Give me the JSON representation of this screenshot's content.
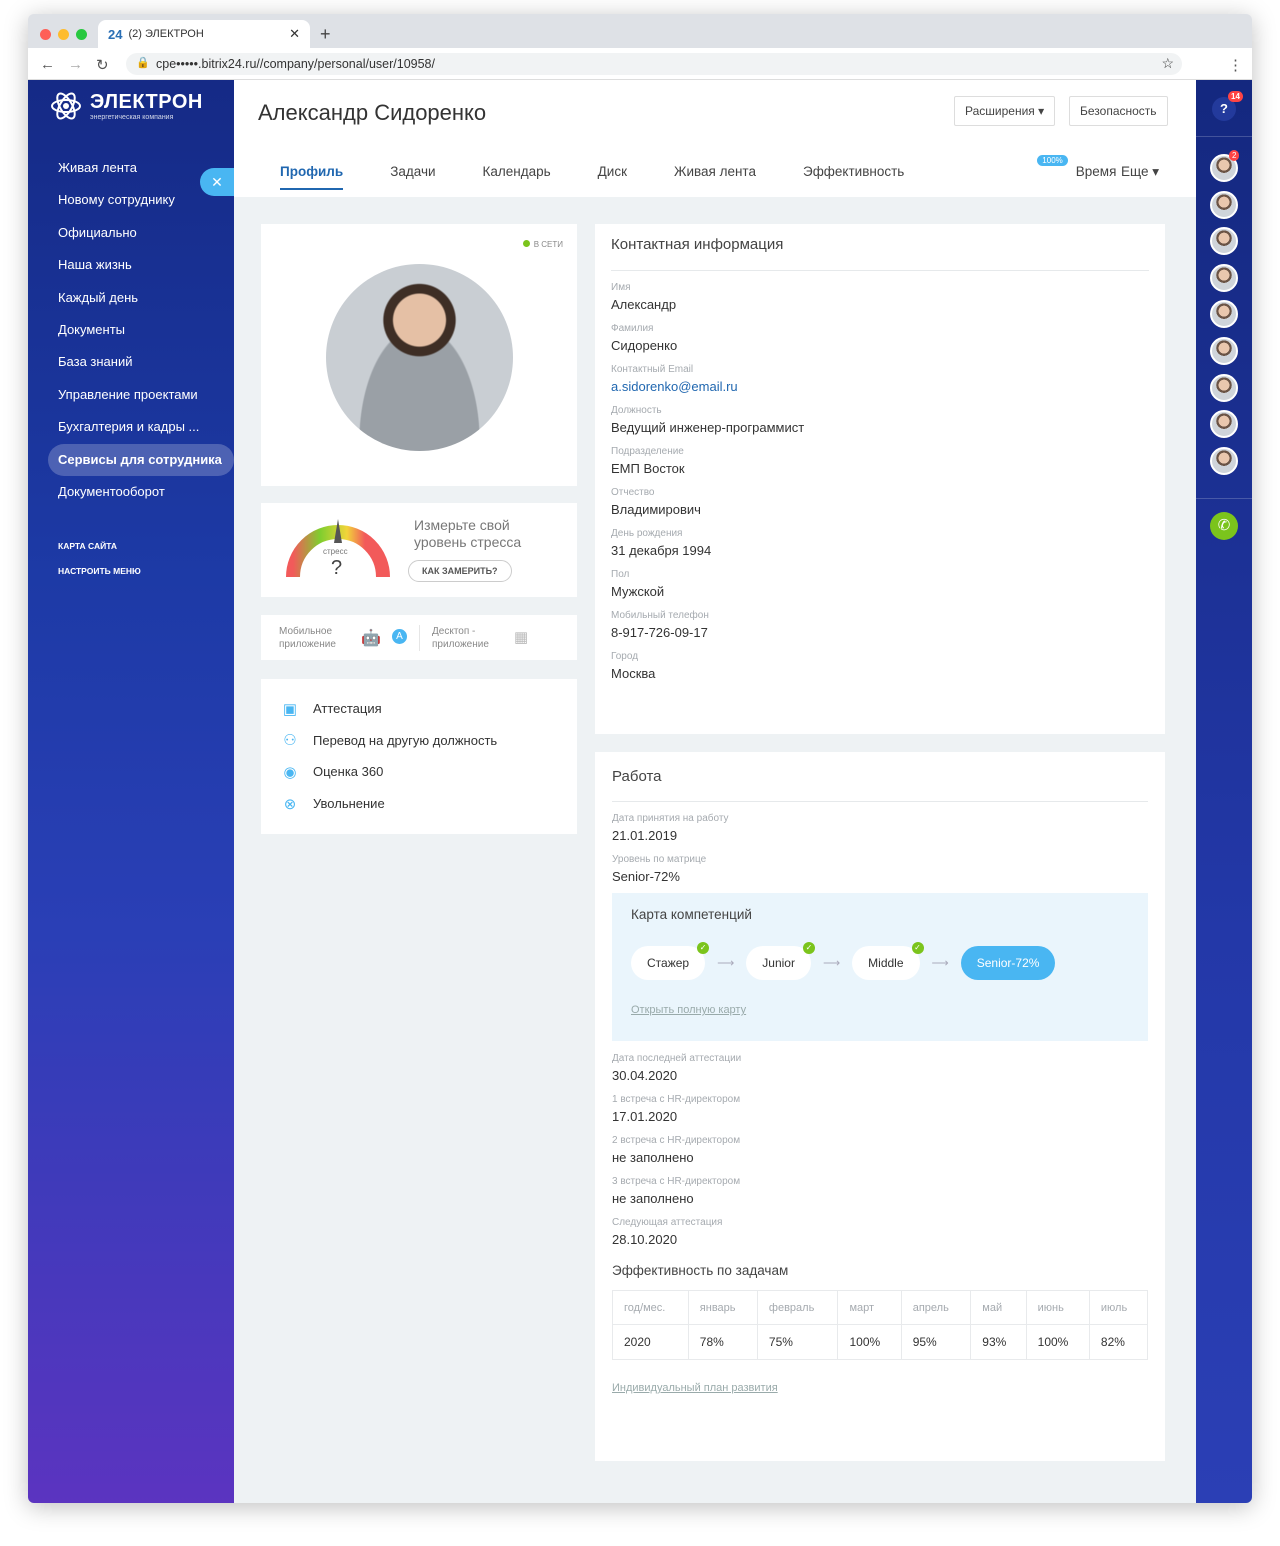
{
  "browser": {
    "tab_title": "(2) ЭЛЕКТРОН",
    "tab_logo": "24",
    "url": "cpe•••••.bitrix24.ru//company/personal/user/10958/"
  },
  "logo": {
    "name": "ЭЛЕКТРОН",
    "subtitle": "энергетическая компания"
  },
  "sidebar": {
    "items": [
      "Живая лента",
      "Новому сотруднику",
      "Официально",
      "Наша жизнь",
      "Каждый день",
      "Документы",
      "База знаний",
      "Управление проектами",
      "Бухгалтерия и кадры ...",
      "Сервисы для сотрудника",
      "Документооборот"
    ],
    "active": "Сервисы для сотрудника",
    "sitemap": "КАРТА САЙТА",
    "configure": "НАСТРОИТЬ МЕНЮ"
  },
  "header": {
    "title": "Александр Сидоренко",
    "extensions": "Расширения",
    "security": "Безопасность",
    "tabs": [
      "Профиль",
      "Задачи",
      "Календарь",
      "Диск",
      "Живая лента",
      "Эффективность",
      "Время"
    ],
    "more": "Еще",
    "efficiency_badge": "100%"
  },
  "profile": {
    "status": "В СЕТИ",
    "status_color": "#7bc41c"
  },
  "stress": {
    "label": "стресс",
    "value": "?",
    "text": "Измерьте свой уровень стресса",
    "button": "КАК ЗАМЕРИТЬ?"
  },
  "apps": {
    "mobile": "Мобильное приложение",
    "desktop": "Десктоп - приложение"
  },
  "actions": [
    {
      "icon": "calendar-check-icon",
      "label": "Аттестация"
    },
    {
      "icon": "users-icon",
      "label": "Перевод на другую должность"
    },
    {
      "icon": "eye-icon",
      "label": "Оценка 360"
    },
    {
      "icon": "close-circle-icon",
      "label": "Увольнение"
    }
  ],
  "contact": {
    "title": "Контактная информация",
    "fields": [
      {
        "label": "Имя",
        "value": "Александр"
      },
      {
        "label": "Фамилия",
        "value": "Сидоренко"
      },
      {
        "label": "Контактный Email",
        "value": "a.sidorenko@email.ru"
      },
      {
        "label": "Должность",
        "value": "Ведущий инженер-программист"
      },
      {
        "label": "Подразделение",
        "value": "ЕМП Восток"
      },
      {
        "label": "Отчество",
        "value": "Владимирович"
      },
      {
        "label": "День рождения",
        "value": "31 декабря 1994"
      },
      {
        "label": "Пол",
        "value": "Мужской"
      },
      {
        "label": "Мобильный телефон",
        "value": "8-917-726-09-17"
      },
      {
        "label": "Город",
        "value": "Москва"
      }
    ]
  },
  "work": {
    "title": "Работа",
    "fields_top": [
      {
        "label": "Дата принятия на работу",
        "value": "21.01.2019"
      },
      {
        "label": "Уровень по матрице",
        "value": "Senior-72%"
      }
    ],
    "competence": {
      "title": "Карта компетенций",
      "stages": [
        "Стажер",
        "Junior",
        "Middle"
      ],
      "current": "Senior-72%",
      "link": "Открыть полную карту"
    },
    "fields_bottom": [
      {
        "label": "Дата последней аттестации",
        "value": "30.04.2020"
      },
      {
        "label": "1 встреча с HR-директором",
        "value": "17.01.2020"
      },
      {
        "label": "2 встреча с HR-директором",
        "value": "не заполнено"
      },
      {
        "label": "3 встреча с HR-директором",
        "value": "не заполнено"
      },
      {
        "label": "Следующая аттестация",
        "value": "28.10.2020"
      }
    ],
    "efficiency_title": "Эффективность по задачам",
    "table": {
      "headers": [
        "год/мес.",
        "январь",
        "февраль",
        "март",
        "апрель",
        "май",
        "июнь",
        "июль"
      ],
      "rows": [
        [
          "2020",
          "78%",
          "75%",
          "100%",
          "95%",
          "93%",
          "100%",
          "82%"
        ]
      ]
    },
    "plan_link": "Индивидуальный план развития"
  },
  "rightbar": {
    "help_badge": "14",
    "avatar_badge": "2"
  }
}
